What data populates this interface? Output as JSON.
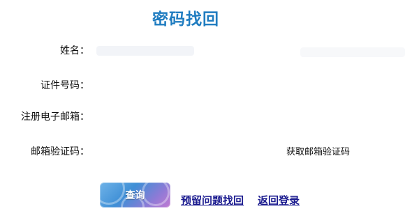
{
  "title": "密码找回",
  "form": {
    "name_label": "姓名：",
    "id_number_label": "证件号码：",
    "email_label": "注册电子邮箱：",
    "email_code_label": "邮箱验证码：",
    "get_email_code_label": "获取邮箱验证码"
  },
  "actions": {
    "query_button_label": "查询",
    "security_question_link": "预留问题找回",
    "back_to_login_link": "返回登录"
  }
}
